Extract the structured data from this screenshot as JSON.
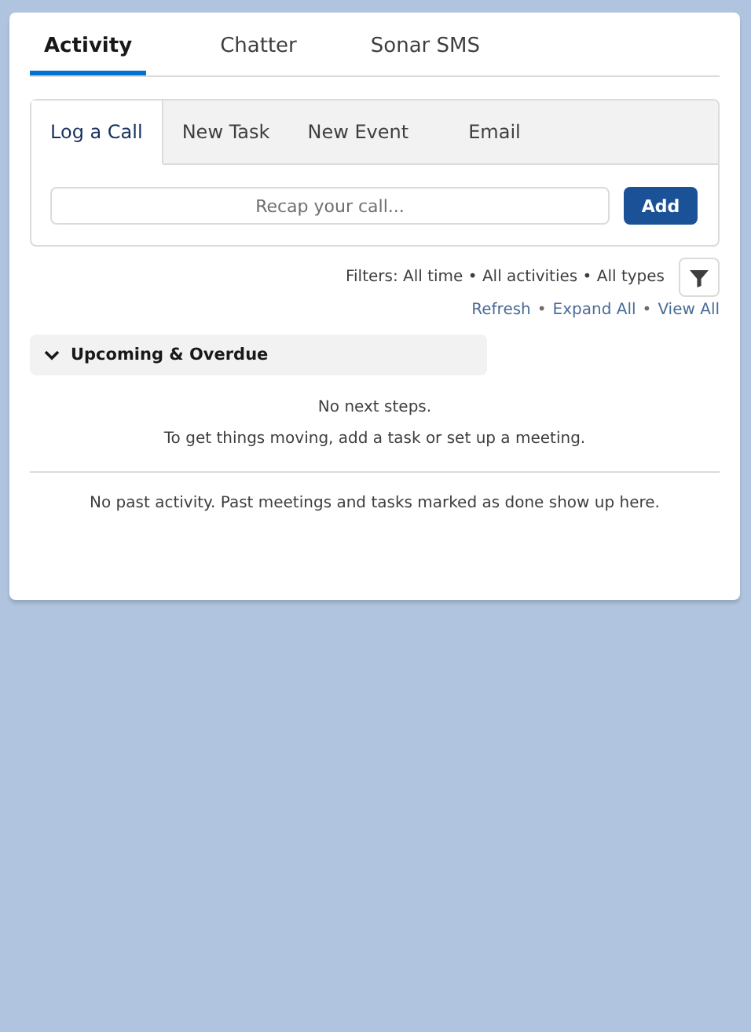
{
  "tabs": [
    {
      "label": "Activity",
      "selected": true
    },
    {
      "label": "Chatter",
      "selected": false
    },
    {
      "label": "Sonar SMS",
      "selected": false
    }
  ],
  "composer": {
    "tabs": [
      {
        "label": "Log a Call",
        "selected": true
      },
      {
        "label": "New Task",
        "selected": false
      },
      {
        "label": "New Event",
        "selected": false
      },
      {
        "label": "Email",
        "selected": false
      }
    ],
    "input": {
      "placeholder": "Recap your call..."
    },
    "button": "Add"
  },
  "filters": {
    "text": "Filters: All time • All activities • All types"
  },
  "links": [
    "Refresh",
    "Expand All",
    "View All"
  ],
  "link_separator": "•",
  "upcoming": {
    "title": "Upcoming & Overdue",
    "expanded": true,
    "empty_lines": [
      "No next steps.",
      "To get things moving, add a task or set up a meeting."
    ]
  },
  "past": {
    "empty_text": "No past activity. Past meetings and tasks marked as done show up here."
  }
}
